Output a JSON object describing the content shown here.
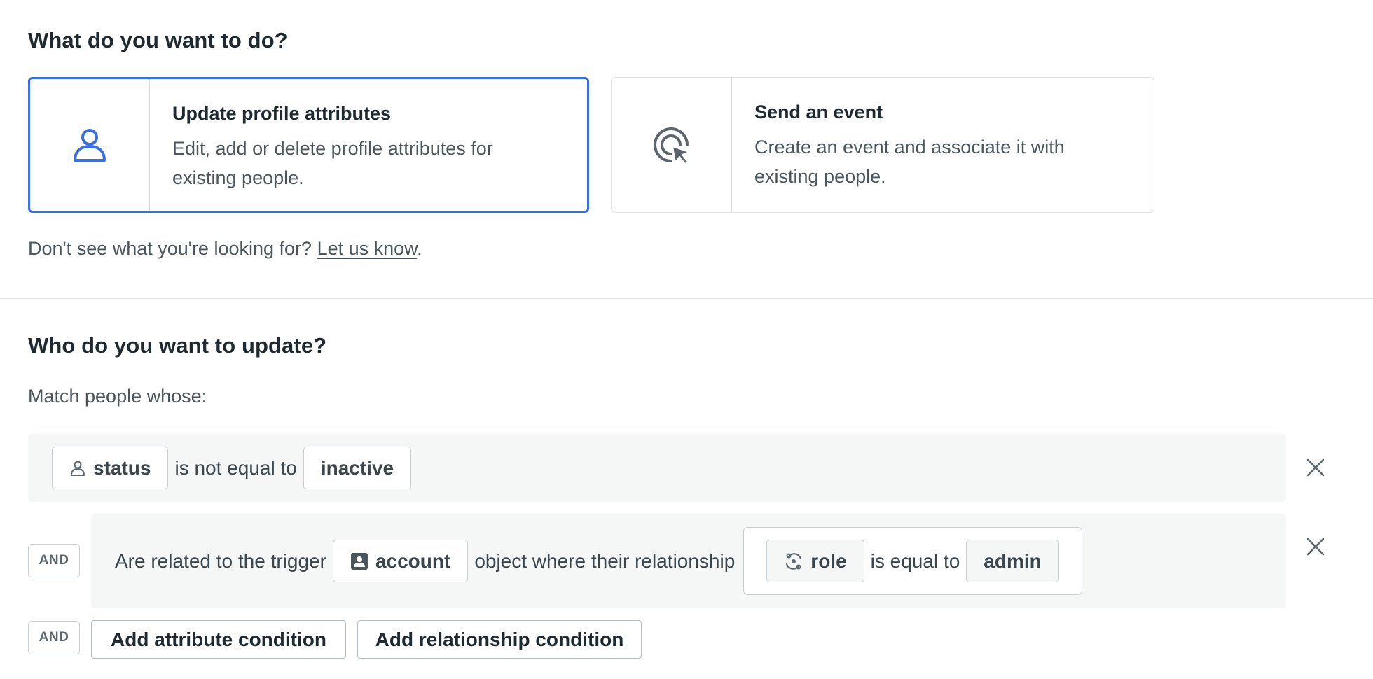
{
  "action_section": {
    "title": "What do you want to do?",
    "cards": [
      {
        "title": "Update profile attributes",
        "description": "Edit, add or delete profile attributes for existing people.",
        "icon": "person-icon",
        "selected": true
      },
      {
        "title": "Send an event",
        "description": "Create an event and associate it with existing people.",
        "icon": "cursor-click-icon",
        "selected": false
      }
    ],
    "help_text": "Don't see what you're looking for?",
    "help_link": "Let us know",
    "help_suffix": "."
  },
  "who_section": {
    "title": "Who do you want to update?",
    "match_label": "Match people whose:",
    "conditions": [
      {
        "attribute": "status",
        "attribute_icon": "person-icon",
        "operator": "is not equal to",
        "value": "inactive"
      },
      {
        "prefix": "Are related to the trigger",
        "object": "account",
        "object_icon": "contact-card-icon",
        "middle": "object where their relationship",
        "rel_attribute": "role",
        "rel_attribute_icon": "relationship-icon",
        "rel_operator": "is equal to",
        "rel_value": "admin"
      }
    ],
    "and_label": "AND",
    "add_attribute_label": "Add attribute condition",
    "add_relationship_label": "Add relationship condition"
  },
  "colors": {
    "accent": "#3a6fe0",
    "row_bg": "#f5f7f7",
    "text": "#1f2a30",
    "muted_text": "#4a555c"
  }
}
